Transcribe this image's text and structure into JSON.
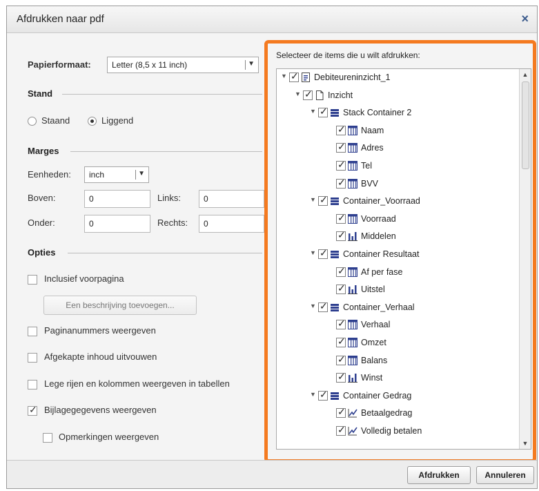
{
  "dialog": {
    "title": "Afdrukken naar pdf",
    "close_glyph": "×"
  },
  "paper": {
    "label": "Papierformaat:",
    "value": "Letter (8,5 x 11 inch)"
  },
  "stand": {
    "title": "Stand",
    "portrait": "Staand",
    "landscape": "Liggend",
    "selected": "landscape"
  },
  "marges": {
    "title": "Marges",
    "units_label": "Eenheden:",
    "units_value": "inch",
    "top_label": "Boven:",
    "top_value": "0",
    "left_label": "Links:",
    "left_value": "0",
    "bottom_label": "Onder:",
    "bottom_value": "0",
    "right_label": "Rechts:",
    "right_value": "0"
  },
  "opties": {
    "title": "Opties",
    "cover": {
      "label": "Inclusief voorpagina",
      "checked": false
    },
    "describe_button": "Een beschrijving toevoegen...",
    "page_numbers": {
      "label": "Paginanummers weergeven",
      "checked": false
    },
    "expand": {
      "label": "Afgekapte inhoud uitvouwen",
      "checked": false
    },
    "empty_rows": {
      "label": "Lege rijen en kolommen weergeven in tabellen",
      "checked": false
    },
    "appendix": {
      "label": "Bijlagegegevens weergeven",
      "checked": true
    },
    "notes": {
      "label": "Opmerkingen weergeven",
      "checked": false
    }
  },
  "tree": {
    "title": "Selecteer de items die u wilt afdrukken:",
    "check_glyph": "✓",
    "items": [
      {
        "label": "Debiteureninzicht_1",
        "icon": "report-icon",
        "level": 0,
        "expander": "▼"
      },
      {
        "label": "Inzicht",
        "icon": "page-icon",
        "level": 1,
        "expander": "▼"
      },
      {
        "label": "Stack Container 2",
        "icon": "container-icon",
        "level": 2,
        "expander": "▼"
      },
      {
        "label": "Naam",
        "icon": "table-icon",
        "level": 3
      },
      {
        "label": "Adres",
        "icon": "table-icon",
        "level": 3
      },
      {
        "label": "Tel",
        "icon": "table-icon",
        "level": 3
      },
      {
        "label": "BVV",
        "icon": "table-icon",
        "level": 3
      },
      {
        "label": "Container_Voorraad",
        "icon": "container-icon",
        "level": 2,
        "expander": "▼"
      },
      {
        "label": "Voorraad",
        "icon": "table-icon",
        "level": 3
      },
      {
        "label": "Middelen",
        "icon": "bar-chart-icon",
        "level": 3
      },
      {
        "label": "Container Resultaat",
        "icon": "container-icon",
        "level": 2,
        "expander": "▼"
      },
      {
        "label": "Af per fase",
        "icon": "table-icon",
        "level": 3
      },
      {
        "label": "Uitstel",
        "icon": "bar-chart-icon",
        "level": 3
      },
      {
        "label": "Container_Verhaal",
        "icon": "container-icon",
        "level": 2,
        "expander": "▼"
      },
      {
        "label": "Verhaal",
        "icon": "table-icon",
        "level": 3
      },
      {
        "label": "Omzet",
        "icon": "table-icon",
        "level": 3
      },
      {
        "label": "Balans",
        "icon": "table-icon",
        "level": 3
      },
      {
        "label": "Winst",
        "icon": "bar-chart-icon",
        "level": 3
      },
      {
        "label": "Container Gedrag",
        "icon": "container-icon",
        "level": 2,
        "expander": "▼"
      },
      {
        "label": "Betaalgedrag",
        "icon": "line-chart-icon",
        "level": 3
      },
      {
        "label": "Volledig betalen",
        "icon": "line-chart-icon",
        "level": 3
      }
    ]
  },
  "footer": {
    "print_label": "Afdrukken",
    "cancel_label": "Annuleren"
  },
  "colors": {
    "highlight": "#f47a20",
    "icon_blue": "#2e3f8f"
  }
}
